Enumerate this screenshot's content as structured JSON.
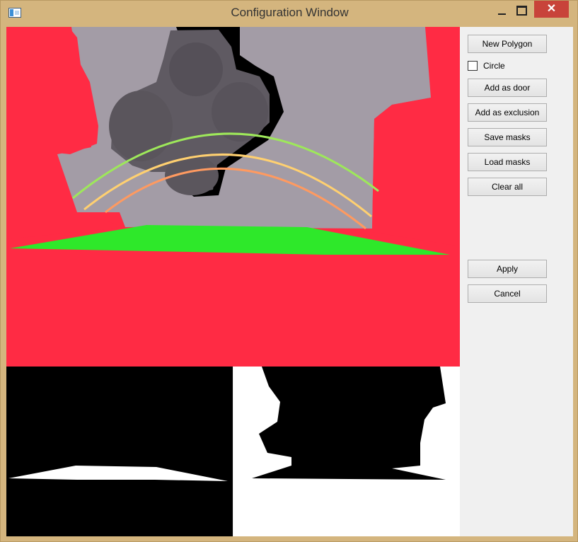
{
  "window": {
    "title": "Configuration Window"
  },
  "panel": {
    "new_polygon": "New Polygon",
    "circle_label": "Circle",
    "circle_checked": false,
    "add_door": "Add as door",
    "add_exclusion": "Add as exclusion",
    "save_masks": "Save masks",
    "load_masks": "Load masks",
    "clear_all": "Clear all",
    "apply": "Apply",
    "cancel": "Cancel"
  },
  "colors": {
    "exclusion_overlay": "#ff2b44",
    "door_polygon": "#2ee82a",
    "depth_background": "#a39ca6",
    "arc_outer": "#9ee85a",
    "arc_middle": "#ffd070",
    "arc_inner": "#ff9a60"
  }
}
